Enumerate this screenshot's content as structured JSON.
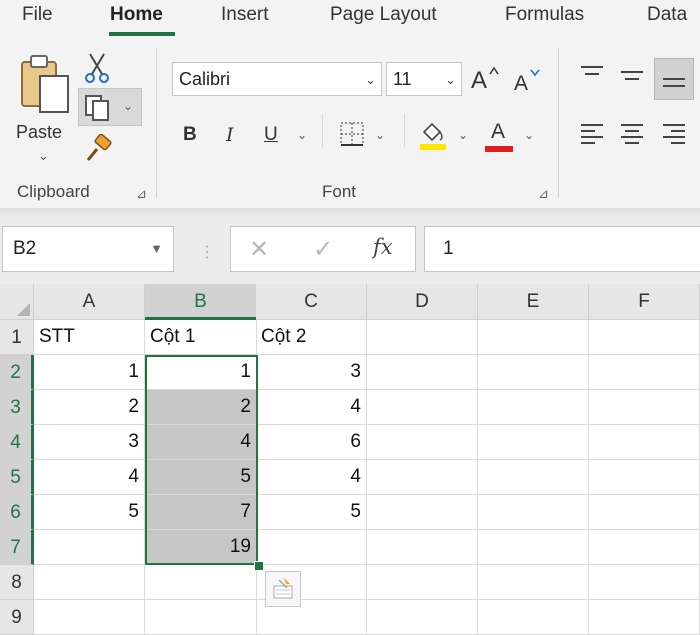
{
  "ribbon_tabs": [
    "File",
    "Home",
    "Insert",
    "Page Layout",
    "Formulas",
    "Data"
  ],
  "clipboard": {
    "paste_label": "Paste",
    "group_label": "Clipboard"
  },
  "font": {
    "font_name": "Calibri",
    "font_size": "11",
    "bold": "B",
    "italic": "I",
    "underline": "U",
    "font_color_glyph": "A",
    "group_label": "Font",
    "highlight_color": "#ffe600",
    "text_color": "#e02020"
  },
  "formula_bar": {
    "name_box": "B2",
    "fx": "fx",
    "value": "1"
  },
  "sheet": {
    "columns": [
      "A",
      "B",
      "C",
      "D",
      "E",
      "F"
    ],
    "rows": [
      "1",
      "2",
      "3",
      "4",
      "5",
      "6",
      "7",
      "8",
      "9"
    ],
    "cells": [
      [
        "STT",
        "Cột 1",
        "Cột 2",
        "",
        "",
        ""
      ],
      [
        "1",
        "1",
        "3",
        "",
        "",
        ""
      ],
      [
        "2",
        "2",
        "4",
        "",
        "",
        ""
      ],
      [
        "3",
        "4",
        "6",
        "",
        "",
        ""
      ],
      [
        "4",
        "5",
        "4",
        "",
        "",
        ""
      ],
      [
        "5",
        "7",
        "5",
        "",
        "",
        ""
      ],
      [
        "",
        "19",
        "",
        "",
        "",
        ""
      ],
      [
        "",
        "",
        "",
        "",
        "",
        ""
      ],
      [
        "",
        "",
        "",
        "",
        "",
        ""
      ]
    ],
    "active_cell": "B2",
    "selection": "B2:B7",
    "accent_color": "#217346"
  }
}
